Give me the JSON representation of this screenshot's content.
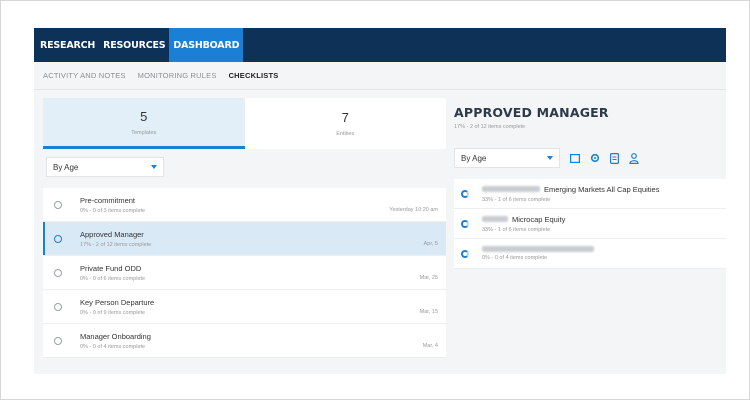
{
  "nav": {
    "tabs": [
      {
        "label": "RESEARCH",
        "active": false
      },
      {
        "label": "RESOURCES",
        "active": false
      },
      {
        "label": "DASHBOARD",
        "active": true
      }
    ]
  },
  "subtabs": [
    {
      "label": "ACTIVITY AND NOTES",
      "active": false
    },
    {
      "label": "MONITORING RULES",
      "active": false
    },
    {
      "label": "CHECKLISTS",
      "active": true
    }
  ],
  "counters": [
    {
      "value": "5",
      "label": "Templates",
      "active": true
    },
    {
      "value": "7",
      "label": "Entities",
      "active": false
    }
  ],
  "left_filter": {
    "value": "By Age"
  },
  "checklists": [
    {
      "title": "Pre-commitment",
      "progress": "0% - 0 of 3 items complete",
      "date": "Yesterday 10:20 am",
      "active": false
    },
    {
      "title": "Approved Manager",
      "progress": "17% - 2 of 12 items complete",
      "date": "Apr, 5",
      "active": true
    },
    {
      "title": "Private Fund ODD",
      "progress": "0% - 0 of 6 items complete",
      "date": "Mar, 25",
      "active": false
    },
    {
      "title": "Key Person Departure",
      "progress": "0% - 0 of 9 items complete",
      "date": "Mar, 15",
      "active": false
    },
    {
      "title": "Manager Onboarding",
      "progress": "0% - 0 of 4 items complete",
      "date": "Mar, 4",
      "active": false
    }
  ],
  "detail": {
    "title": "APPROVED MANAGER",
    "subtitle": "17% - 2 of 12 items complete",
    "filter": "By Age",
    "icons": [
      "calendar-icon",
      "settings-icon",
      "document-icon",
      "person-icon"
    ],
    "items": [
      {
        "name": "Emerging Markets All Cap Equities",
        "progress": "33% - 1 of 6 items complete"
      },
      {
        "name": "Microcap Equity",
        "progress": "33% - 1 of 6 items complete"
      },
      {
        "name": "",
        "progress": "0% - 0 of 4 items complete"
      }
    ]
  },
  "colors": {
    "nav_bg": "#0d3157",
    "accent": "#1b7fd6",
    "selected_row": "#d9e9f6"
  }
}
